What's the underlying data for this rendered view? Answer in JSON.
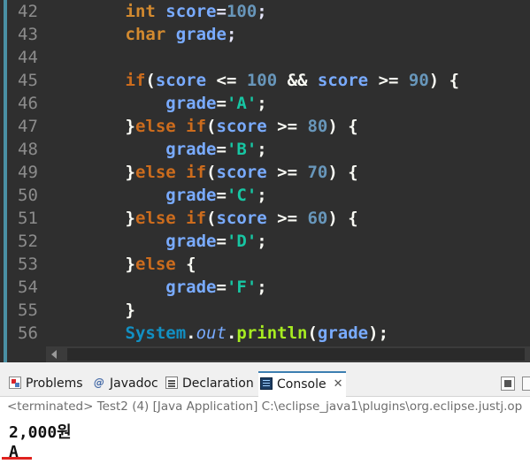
{
  "editor": {
    "lines": [
      {
        "number": "42",
        "tokens": [
          {
            "t": "        ",
            "c": "def"
          },
          {
            "t": "int",
            "c": "type"
          },
          {
            "t": " ",
            "c": "def"
          },
          {
            "t": "score",
            "c": "var"
          },
          {
            "t": "=",
            "c": "op"
          },
          {
            "t": "100",
            "c": "num"
          },
          {
            "t": ";",
            "c": "op"
          }
        ]
      },
      {
        "number": "43",
        "tokens": [
          {
            "t": "        ",
            "c": "def"
          },
          {
            "t": "char",
            "c": "type"
          },
          {
            "t": " ",
            "c": "def"
          },
          {
            "t": "grade",
            "c": "var"
          },
          {
            "t": ";",
            "c": "op"
          }
        ]
      },
      {
        "number": "44",
        "tokens": []
      },
      {
        "number": "45",
        "tokens": [
          {
            "t": "        ",
            "c": "def"
          },
          {
            "t": "if",
            "c": "kw"
          },
          {
            "t": "(",
            "c": "white"
          },
          {
            "t": "score",
            "c": "var"
          },
          {
            "t": " <= ",
            "c": "white"
          },
          {
            "t": "100",
            "c": "num"
          },
          {
            "t": " && ",
            "c": "white"
          },
          {
            "t": "score",
            "c": "var"
          },
          {
            "t": " >= ",
            "c": "white"
          },
          {
            "t": "90",
            "c": "num"
          },
          {
            "t": ") {",
            "c": "white"
          }
        ]
      },
      {
        "number": "46",
        "tokens": [
          {
            "t": "            ",
            "c": "def"
          },
          {
            "t": "grade",
            "c": "var"
          },
          {
            "t": "=",
            "c": "white"
          },
          {
            "t": "'A'",
            "c": "chr"
          },
          {
            "t": ";",
            "c": "white"
          }
        ]
      },
      {
        "number": "47",
        "tokens": [
          {
            "t": "        }",
            "c": "white"
          },
          {
            "t": "else if",
            "c": "kw"
          },
          {
            "t": "(",
            "c": "white"
          },
          {
            "t": "score",
            "c": "var"
          },
          {
            "t": " >= ",
            "c": "white"
          },
          {
            "t": "80",
            "c": "num"
          },
          {
            "t": ") {",
            "c": "white"
          }
        ]
      },
      {
        "number": "48",
        "tokens": [
          {
            "t": "            ",
            "c": "def"
          },
          {
            "t": "grade",
            "c": "var"
          },
          {
            "t": "=",
            "c": "white"
          },
          {
            "t": "'B'",
            "c": "chr"
          },
          {
            "t": ";",
            "c": "white"
          }
        ]
      },
      {
        "number": "49",
        "tokens": [
          {
            "t": "        }",
            "c": "white"
          },
          {
            "t": "else if",
            "c": "kw"
          },
          {
            "t": "(",
            "c": "white"
          },
          {
            "t": "score",
            "c": "var"
          },
          {
            "t": " >= ",
            "c": "white"
          },
          {
            "t": "70",
            "c": "num"
          },
          {
            "t": ") {",
            "c": "white"
          }
        ]
      },
      {
        "number": "50",
        "tokens": [
          {
            "t": "            ",
            "c": "def"
          },
          {
            "t": "grade",
            "c": "var"
          },
          {
            "t": "=",
            "c": "white"
          },
          {
            "t": "'C'",
            "c": "chr"
          },
          {
            "t": ";",
            "c": "white"
          }
        ]
      },
      {
        "number": "51",
        "tokens": [
          {
            "t": "        }",
            "c": "white"
          },
          {
            "t": "else if",
            "c": "kw"
          },
          {
            "t": "(",
            "c": "white"
          },
          {
            "t": "score",
            "c": "var"
          },
          {
            "t": " >= ",
            "c": "white"
          },
          {
            "t": "60",
            "c": "num"
          },
          {
            "t": ") {",
            "c": "white"
          }
        ]
      },
      {
        "number": "52",
        "tokens": [
          {
            "t": "            ",
            "c": "def"
          },
          {
            "t": "grade",
            "c": "var"
          },
          {
            "t": "=",
            "c": "white"
          },
          {
            "t": "'D'",
            "c": "chr"
          },
          {
            "t": ";",
            "c": "white"
          }
        ]
      },
      {
        "number": "53",
        "tokens": [
          {
            "t": "        }",
            "c": "white"
          },
          {
            "t": "else",
            "c": "kw"
          },
          {
            "t": " {",
            "c": "white"
          }
        ]
      },
      {
        "number": "54",
        "tokens": [
          {
            "t": "            ",
            "c": "def"
          },
          {
            "t": "grade",
            "c": "var"
          },
          {
            "t": "=",
            "c": "white"
          },
          {
            "t": "'F'",
            "c": "chr"
          },
          {
            "t": ";",
            "c": "white"
          }
        ]
      },
      {
        "number": "55",
        "tokens": [
          {
            "t": "        }",
            "c": "white"
          }
        ]
      },
      {
        "number": "56",
        "tokens": [
          {
            "t": "        ",
            "c": "def"
          },
          {
            "t": "System",
            "c": "cls"
          },
          {
            "t": ".",
            "c": "white"
          },
          {
            "t": "out",
            "c": "fld"
          },
          {
            "t": ".",
            "c": "white"
          },
          {
            "t": "println",
            "c": "mth"
          },
          {
            "t": "(",
            "c": "white"
          },
          {
            "t": "grade",
            "c": "var"
          },
          {
            "t": ");",
            "c": "white"
          }
        ]
      }
    ]
  },
  "console_view": {
    "tabs": [
      {
        "label": "Problems",
        "icon": "problems-icon"
      },
      {
        "label": "Javadoc",
        "icon": "javadoc-icon"
      },
      {
        "label": "Declaration",
        "icon": "declaration-icon"
      },
      {
        "label": "Console",
        "icon": "console-icon",
        "active": true
      }
    ],
    "status": "<terminated> Test2 (4) [Java Application] C:\\eclipse_java1\\plugins\\org.eclipse.justj.op",
    "output": [
      "2,000원",
      "A"
    ]
  },
  "colors": {
    "editor_bg": "#2f2f2f",
    "keyword": "#cc6c1d",
    "variable": "#79abff",
    "number": "#6897bb",
    "char_literal": "#17c6a3",
    "method": "#a7ec21",
    "active_tab_accent": "#3c7fb1",
    "annotation_underline": "#e0221e"
  }
}
